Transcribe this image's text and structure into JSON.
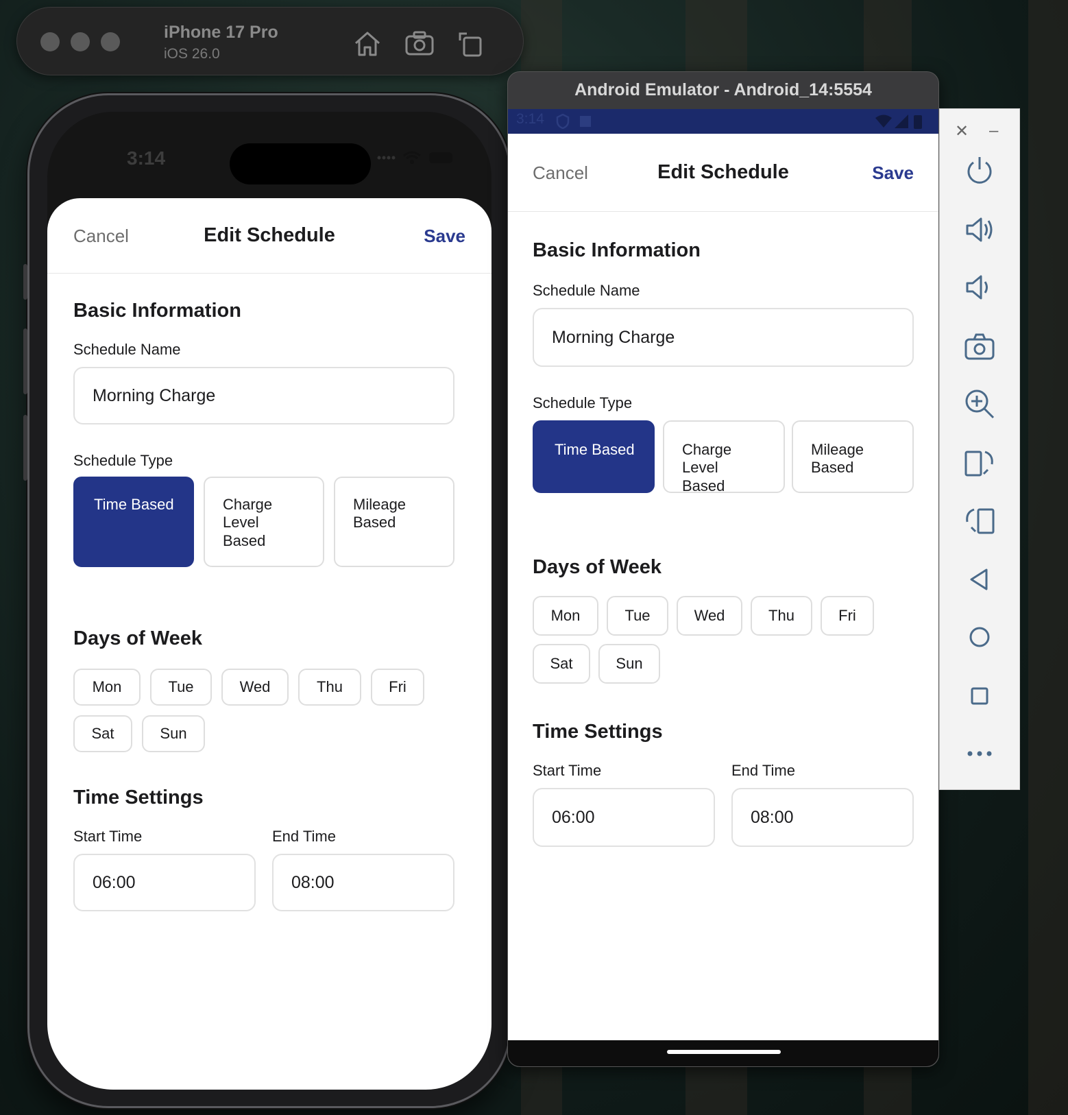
{
  "ios_simulator": {
    "device_name": "iPhone 17 Pro",
    "os_version": "iOS 26.0",
    "status_time": "3:14"
  },
  "android_emulator": {
    "window_title": "Android Emulator - Android_14:5554",
    "status_time": "3:14"
  },
  "form": {
    "cancel_label": "Cancel",
    "title": "Edit Schedule",
    "save_label": "Save",
    "basic_info_heading": "Basic Information",
    "schedule_name_label": "Schedule Name",
    "schedule_name_value": "Morning Charge",
    "schedule_type_label": "Schedule Type",
    "schedule_types": [
      "Time Based",
      "Charge Level Based",
      "Mileage Based"
    ],
    "selected_type": "Time Based",
    "days_heading": "Days of Week",
    "days": [
      "Mon",
      "Tue",
      "Wed",
      "Thu",
      "Fri",
      "Sat",
      "Sun"
    ],
    "time_heading": "Time Settings",
    "start_time_label": "Start Time",
    "start_time_value": "06:00",
    "end_time_label": "End Time",
    "end_time_value": "08:00"
  },
  "colors": {
    "accent": "#233588",
    "save_text": "#2a3a8f",
    "android_status_bar": "#1b2a6b"
  },
  "emulator_panel_icons": [
    "close-icon",
    "minimize-icon",
    "power-icon",
    "volume-up-icon",
    "volume-down-icon",
    "camera-icon",
    "zoom-in-icon",
    "rotate-left-icon",
    "rotate-right-icon",
    "back-icon",
    "home-icon",
    "overview-icon",
    "more-icon"
  ]
}
